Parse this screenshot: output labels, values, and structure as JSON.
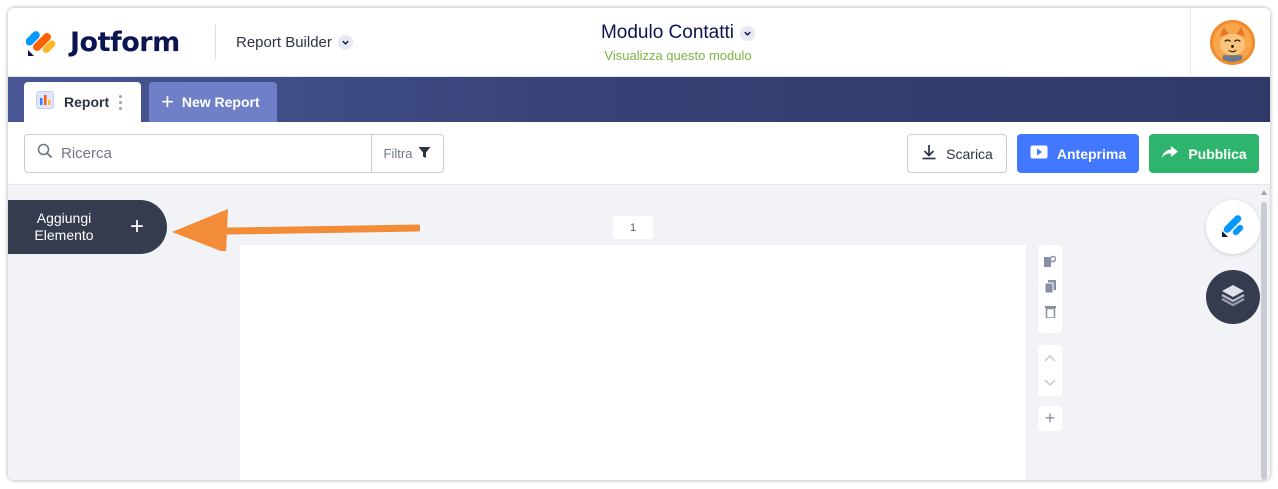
{
  "header": {
    "logo_text": "Jotform",
    "builder_label": "Report Builder",
    "form_name": "Modulo Contatti",
    "form_link": "Visualizza questo modulo"
  },
  "tabs": {
    "report_label": "Report",
    "new_report_label": "New Report"
  },
  "toolbar": {
    "search_placeholder": "Ricerca",
    "filter_label": "Filtra",
    "download_label": "Scarica",
    "preview_label": "Anteprima",
    "publish_label": "Pubblica"
  },
  "canvas": {
    "add_element_line1": "Aggiungi",
    "add_element_line2": "Elemento",
    "page_number": "1"
  },
  "colors": {
    "brand_navy": "#0a1551",
    "preview_blue": "#4277ff",
    "publish_green": "#2fb46e",
    "form_link_green": "#7cb342",
    "annotation_orange": "#f28c38"
  },
  "icons": [
    "jotform-logo-icon",
    "chevron-down-icon",
    "avatar",
    "report-chart-icon",
    "kebab-icon",
    "plus-icon",
    "search-icon",
    "filter-icon",
    "download-icon",
    "play-icon",
    "share-arrow-icon",
    "settings-icon",
    "copy-icon",
    "trash-icon",
    "chevron-up-icon",
    "layers-icon"
  ]
}
